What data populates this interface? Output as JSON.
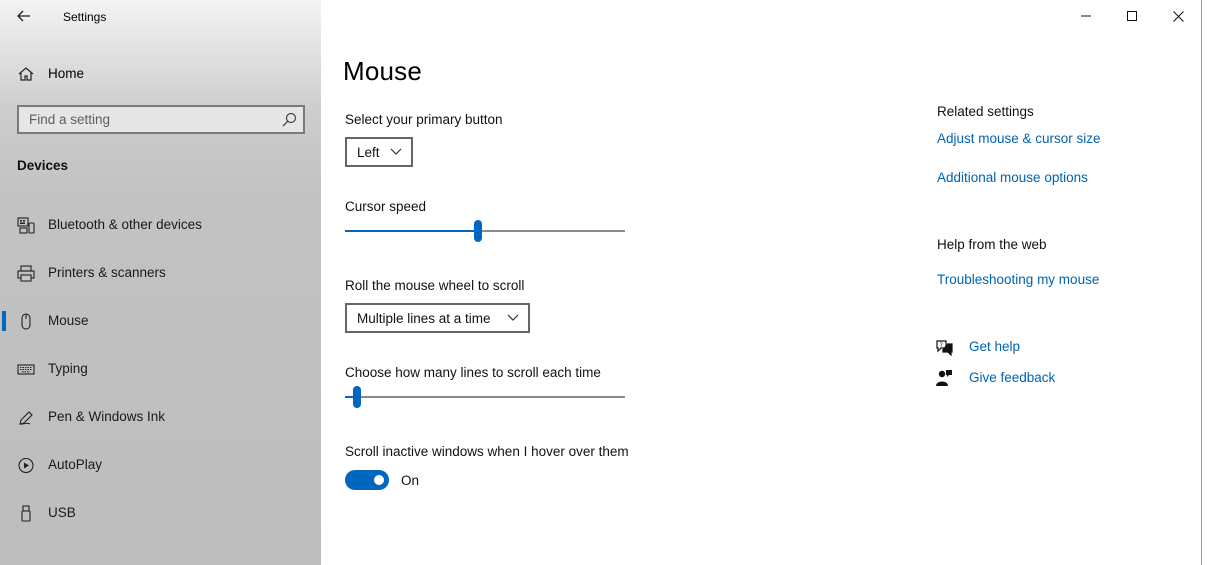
{
  "window": {
    "app_title": "Settings"
  },
  "sidebar": {
    "home_label": "Home",
    "search_placeholder": "Find a setting",
    "section_title": "Devices",
    "items": [
      {
        "label": "Bluetooth & other devices",
        "icon": "bluetooth-devices-icon"
      },
      {
        "label": "Printers & scanners",
        "icon": "printer-icon"
      },
      {
        "label": "Mouse",
        "icon": "mouse-icon",
        "selected": true
      },
      {
        "label": "Typing",
        "icon": "keyboard-icon"
      },
      {
        "label": "Pen & Windows Ink",
        "icon": "pen-icon"
      },
      {
        "label": "AutoPlay",
        "icon": "autoplay-icon"
      },
      {
        "label": "USB",
        "icon": "usb-icon"
      }
    ]
  },
  "main": {
    "page_title": "Mouse",
    "primary_button": {
      "label": "Select your primary button",
      "value": "Left"
    },
    "cursor_speed": {
      "label": "Cursor speed",
      "fraction": 0.475
    },
    "scroll_mode": {
      "label": "Roll the mouse wheel to scroll",
      "value": "Multiple lines at a time"
    },
    "scroll_lines": {
      "label": "Choose how many lines to scroll each time",
      "fraction": 0.03
    },
    "inactive_scroll": {
      "label": "Scroll inactive windows when I hover over them",
      "state": "On",
      "enabled": true
    }
  },
  "related": {
    "title": "Related settings",
    "links": [
      "Adjust mouse & cursor size",
      "Additional mouse options"
    ],
    "help_title": "Help from the web",
    "help_links": [
      "Troubleshooting my mouse"
    ],
    "get_help": "Get help",
    "give_feedback": "Give feedback"
  },
  "colors": {
    "accent": "#0067c0",
    "link": "#0063b1"
  }
}
